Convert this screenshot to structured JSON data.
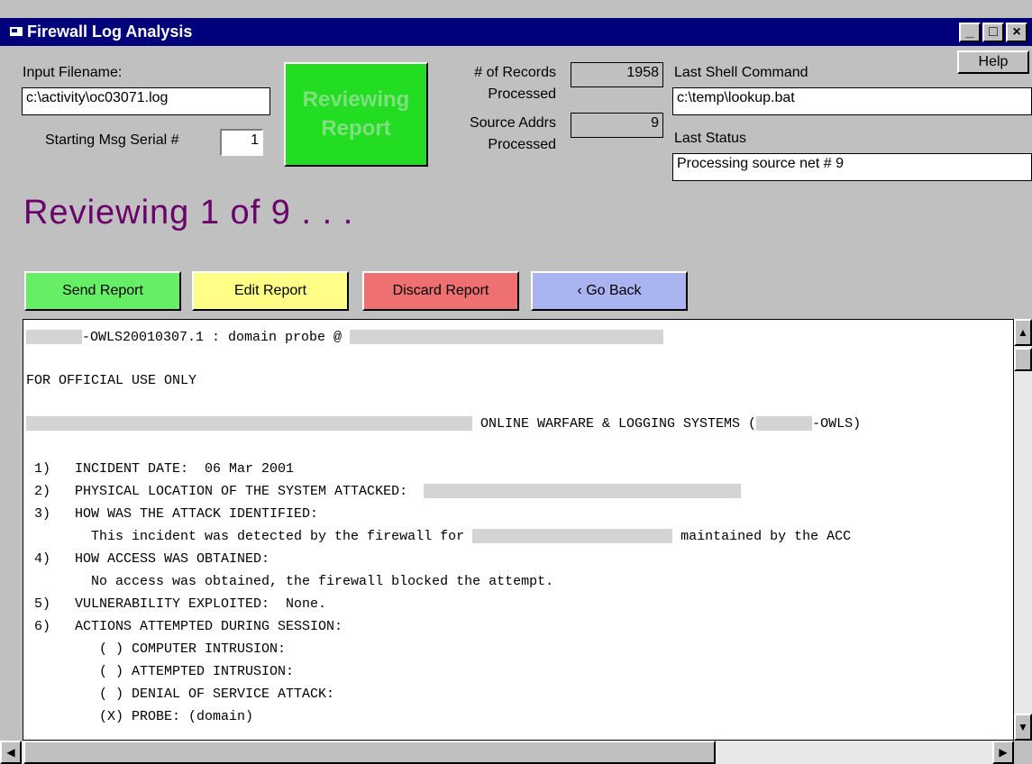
{
  "window": {
    "title": "Firewall Log Analysis",
    "minimize": "_",
    "maximize": "□",
    "close": "×"
  },
  "colors": {
    "title_bar": "#00007b",
    "status_box": "#22dd22",
    "reviewing_text": "#6a006a",
    "send": "#66ee66",
    "edit": "#ffff88",
    "discard": "#ee7070",
    "go_back": "#aab4f0"
  },
  "form": {
    "input_filename_label": "Input Filename:",
    "input_filename_value": "c:\\activity\\oc03071.log",
    "serial_label": "Starting Msg Serial #",
    "serial_value": "1",
    "status_box_line1": "Reviewing",
    "status_box_line2": "Report",
    "records_label_1": "# of Records",
    "records_label_2": "Processed",
    "records_value": "1958",
    "source_label_1": "Source Addrs",
    "source_label_2": "Processed",
    "source_value": "9",
    "last_shell_label": "Last Shell Command",
    "last_shell_value": "c:\\temp\\lookup.bat",
    "last_status_label": "Last Status",
    "last_status_value": "Processing source net # 9",
    "help": "Help"
  },
  "reviewing": "Reviewing  1  of  9 . . .",
  "actions": {
    "send": "Send Report",
    "edit": "Edit Report",
    "discard": "Discard Report",
    "go_back": "‹ Go Back"
  },
  "report": {
    "line1": "-OWLS20010307.1 : domain probe @ ",
    "line2": "FOR OFFICIAL USE ONLY",
    "line3a": " ONLINE WARFARE & LOGGING SYSTEMS (",
    "line3b": "-OWLS)",
    "item1": " 1)   INCIDENT DATE:  06 Mar 2001",
    "item2": " 2)   PHYSICAL LOCATION OF THE SYSTEM ATTACKED:  ",
    "item3": " 3)   HOW WAS THE ATTACK IDENTIFIED:",
    "item3a": "        This incident was detected by the firewall for ",
    "item3b": " maintained by the ACC",
    "item4": " 4)   HOW ACCESS WAS OBTAINED:",
    "item4a": "        No access was obtained, the firewall blocked the attempt.",
    "item5": " 5)   VULNERABILITY EXPLOITED:  None.",
    "item6": " 6)   ACTIONS ATTEMPTED DURING SESSION:",
    "opt1": "         ( ) COMPUTER INTRUSION:",
    "opt2": "         ( ) ATTEMPTED INTRUSION:",
    "opt3": "         ( ) DENIAL OF SERVICE ATTACK:",
    "opt4": "         (X) PROBE: (domain)"
  }
}
